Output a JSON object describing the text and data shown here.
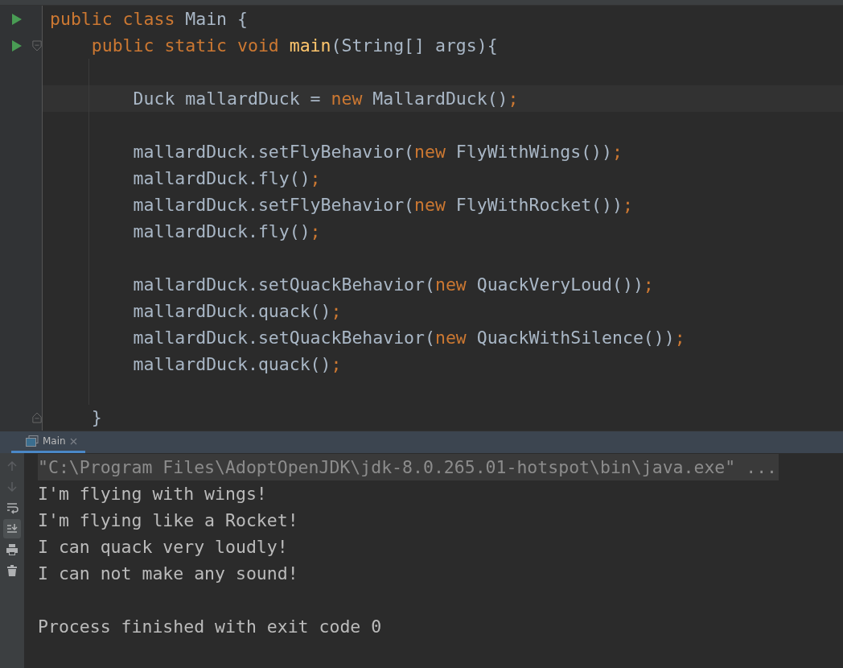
{
  "editor": {
    "lines": [
      {
        "kind": "code",
        "run": true,
        "tokens": [
          {
            "kind": "kw",
            "text": "public class "
          },
          {
            "kind": "id",
            "text": "Main {"
          }
        ]
      },
      {
        "kind": "code",
        "run": true,
        "fold_start": true,
        "tokens": [
          {
            "kind": "kw",
            "text": "    public static void "
          },
          {
            "kind": "fn",
            "text": "main"
          },
          {
            "kind": "id",
            "text": "(String[] args){"
          }
        ]
      },
      {
        "kind": "blank"
      },
      {
        "kind": "code",
        "current": true,
        "tokens": [
          {
            "kind": "id",
            "text": "        Duck mallardDuck = "
          },
          {
            "kind": "kw",
            "text": "new "
          },
          {
            "kind": "id",
            "text": "MallardDuck()"
          },
          {
            "kind": "kw",
            "text": ";"
          }
        ]
      },
      {
        "kind": "blank"
      },
      {
        "kind": "code",
        "tokens": [
          {
            "kind": "id",
            "text": "        mallardDuck.setFlyBehavior("
          },
          {
            "kind": "kw",
            "text": "new "
          },
          {
            "kind": "id",
            "text": "FlyWithWings())"
          },
          {
            "kind": "kw",
            "text": ";"
          }
        ]
      },
      {
        "kind": "code",
        "tokens": [
          {
            "kind": "id",
            "text": "        mallardDuck.fly()"
          },
          {
            "kind": "kw",
            "text": ";"
          }
        ]
      },
      {
        "kind": "code",
        "tokens": [
          {
            "kind": "id",
            "text": "        mallardDuck.setFlyBehavior("
          },
          {
            "kind": "kw",
            "text": "new "
          },
          {
            "kind": "id",
            "text": "FlyWithRocket())"
          },
          {
            "kind": "kw",
            "text": ";"
          }
        ]
      },
      {
        "kind": "code",
        "tokens": [
          {
            "kind": "id",
            "text": "        mallardDuck.fly()"
          },
          {
            "kind": "kw",
            "text": ";"
          }
        ]
      },
      {
        "kind": "blank"
      },
      {
        "kind": "code",
        "tokens": [
          {
            "kind": "id",
            "text": "        mallardDuck.setQuackBehavior("
          },
          {
            "kind": "kw",
            "text": "new "
          },
          {
            "kind": "id",
            "text": "QuackVeryLoud())"
          },
          {
            "kind": "kw",
            "text": ";"
          }
        ]
      },
      {
        "kind": "code",
        "tokens": [
          {
            "kind": "id",
            "text": "        mallardDuck.quack()"
          },
          {
            "kind": "kw",
            "text": ";"
          }
        ]
      },
      {
        "kind": "code",
        "tokens": [
          {
            "kind": "id",
            "text": "        mallardDuck.setQuackBehavior("
          },
          {
            "kind": "kw",
            "text": "new "
          },
          {
            "kind": "id",
            "text": "QuackWithSilence())"
          },
          {
            "kind": "kw",
            "text": ";"
          }
        ]
      },
      {
        "kind": "code",
        "tokens": [
          {
            "kind": "id",
            "text": "        mallardDuck.quack()"
          },
          {
            "kind": "kw",
            "text": ";"
          }
        ]
      },
      {
        "kind": "blank"
      },
      {
        "kind": "code",
        "fold_end": true,
        "tokens": [
          {
            "kind": "id",
            "text": "    }"
          }
        ]
      }
    ]
  },
  "run_panel": {
    "tabs": [
      {
        "label": "Main",
        "selected": true
      }
    ],
    "toolbar": [
      {
        "kind": "up",
        "disabled": true,
        "selected": false
      },
      {
        "kind": "down",
        "disabled": true,
        "selected": false
      },
      {
        "kind": "wrap",
        "disabled": false,
        "selected": false
      },
      {
        "kind": "scroll",
        "disabled": false,
        "selected": true
      },
      {
        "kind": "print",
        "disabled": false,
        "selected": false
      },
      {
        "kind": "trash",
        "disabled": false,
        "selected": false
      }
    ],
    "lines": [
      {
        "kind": "command",
        "text": "\"C:\\Program Files\\AdoptOpenJDK\\jdk-8.0.265.01-hotspot\\bin\\java.exe\" ..."
      },
      {
        "kind": "output",
        "text": "I'm flying with wings!"
      },
      {
        "kind": "output",
        "text": "I'm flying like a Rocket!"
      },
      {
        "kind": "output",
        "text": "I can quack very loudly!"
      },
      {
        "kind": "output",
        "text": "I can not make any sound!"
      },
      {
        "kind": "blank"
      },
      {
        "kind": "output",
        "text": "Process finished with exit code 0"
      }
    ]
  }
}
